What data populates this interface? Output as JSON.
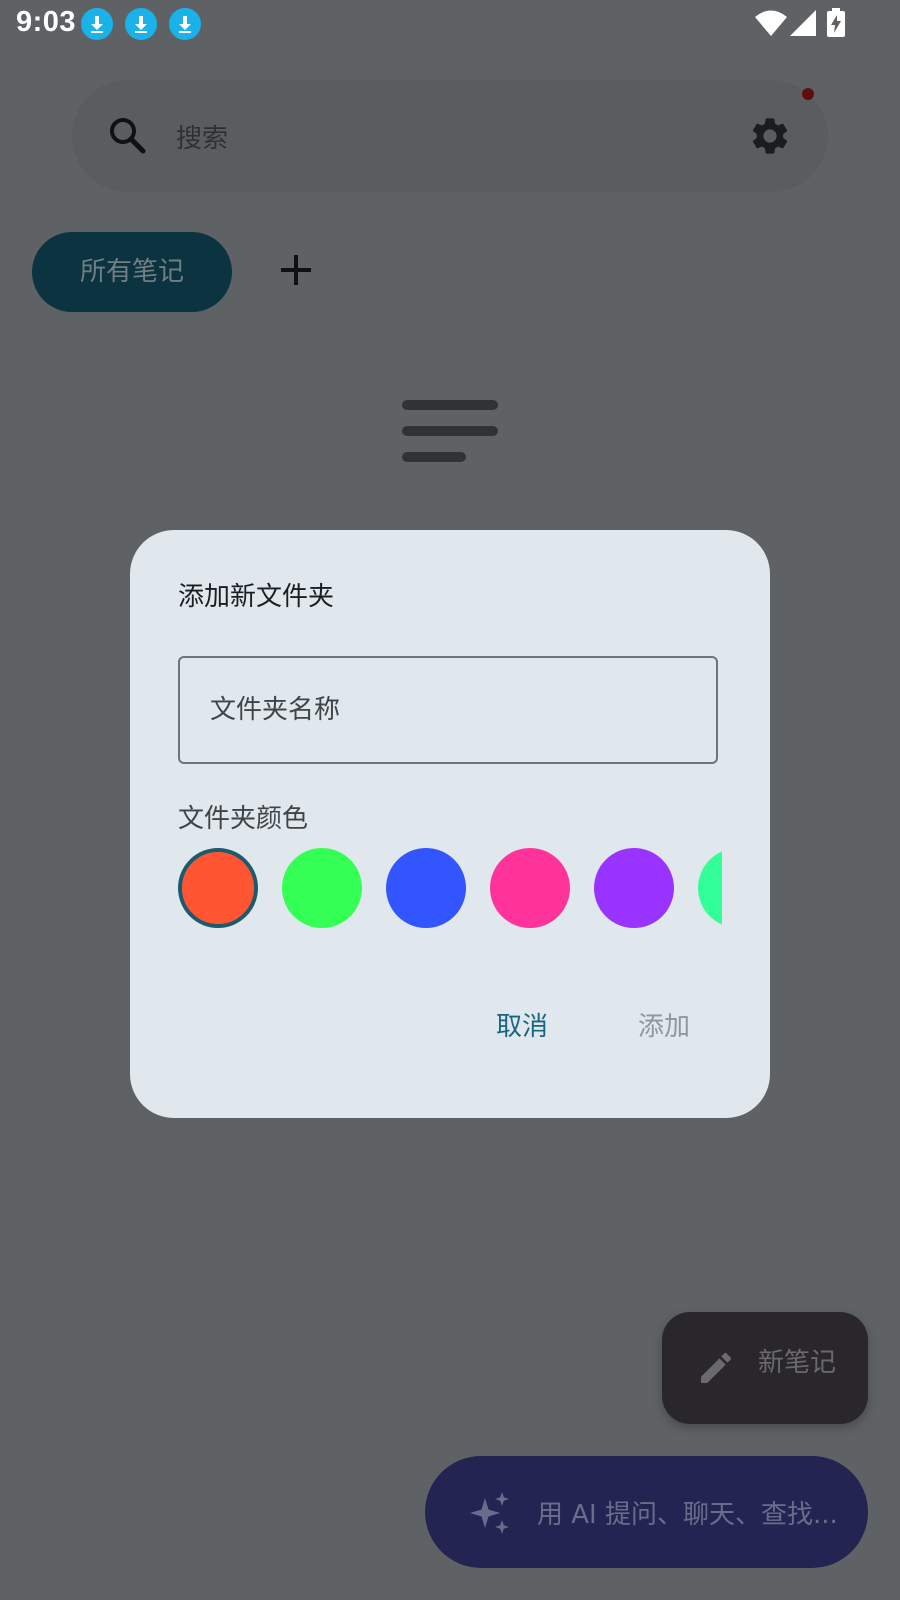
{
  "status_bar": {
    "time": "9:03",
    "notification_icons": [
      "download-icon",
      "download-icon",
      "download-icon"
    ],
    "right_icons": [
      "wifi-icon",
      "signal-icon",
      "battery-charging-icon"
    ]
  },
  "search": {
    "placeholder": "搜索"
  },
  "folders": {
    "all_notes_label": "所有笔记"
  },
  "dialog": {
    "title": "添加新文件夹",
    "name_placeholder": "文件夹名称",
    "color_label": "文件夹颜色",
    "colors": [
      "#ff5533",
      "#33ff55",
      "#3355ff",
      "#ff3399",
      "#9933ff",
      "#33ff99"
    ],
    "selected_color_index": 0,
    "cancel_label": "取消",
    "add_label": "添加"
  },
  "fab": {
    "new_note_label": "新笔记",
    "ai_label": "用 AI 提问、聊天、查找..."
  }
}
